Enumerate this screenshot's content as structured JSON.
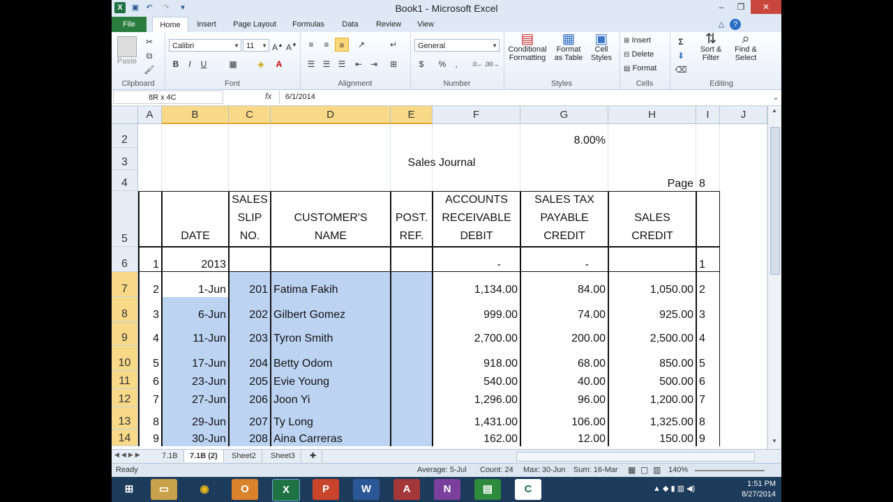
{
  "window": {
    "title": "Book1 - Microsoft Excel",
    "min": "–",
    "restore": "❐",
    "close": "✕"
  },
  "quick_access": {
    "save_icon": "save-icon",
    "undo_icon": "undo-icon",
    "redo_icon": "redo-icon"
  },
  "ribbon_tabs": [
    "File",
    "Home",
    "Insert",
    "Page Layout",
    "Formulas",
    "Data",
    "Review",
    "View"
  ],
  "ribbon": {
    "clipboard": {
      "label": "Clipboard",
      "paste": "Paste"
    },
    "font": {
      "label": "Font",
      "name": "Calibri",
      "size": "11",
      "bold": "B",
      "italic": "I",
      "underline": "U"
    },
    "alignment": {
      "label": "Alignment"
    },
    "number": {
      "label": "Number",
      "format": "General",
      "currency": "$",
      "percent": "%",
      "comma": ","
    },
    "styles": {
      "label": "Styles",
      "conditional": "Conditional Formatting",
      "format_table": "Format as Table",
      "cell_styles": "Cell Styles"
    },
    "cells": {
      "label": "Cells",
      "insert": "Insert",
      "delete": "Delete",
      "format": "Format"
    },
    "editing": {
      "label": "Editing",
      "sort": "Sort & Filter",
      "find": "Find & Select",
      "autosum": "Σ"
    }
  },
  "formula_bar": {
    "name_box": "8R x 4C",
    "fx": "fx",
    "value": "6/1/2014"
  },
  "columns": [
    "A",
    "B",
    "C",
    "D",
    "E",
    "F",
    "G",
    "H",
    "I",
    "J"
  ],
  "rows": [
    "2",
    "3",
    "4",
    "5",
    "6",
    "7",
    "8",
    "9",
    "10",
    "11",
    "12",
    "13",
    "14"
  ],
  "sheet": {
    "tax_rate": "8.00%",
    "title": "Sales Journal",
    "page_label": "Page",
    "page_number": "8",
    "headers": {
      "date": "DATE",
      "slip": [
        "SALES",
        "SLIP",
        "NO."
      ],
      "customer": [
        "CUSTOMER'S",
        "NAME"
      ],
      "post": [
        "POST.",
        "REF."
      ],
      "ar": [
        "ACCOUNTS",
        "RECEIVABLE",
        "DEBIT"
      ],
      "tax": [
        "SALES TAX",
        "PAYABLE",
        "CREDIT"
      ],
      "sales": [
        "SALES",
        "CREDIT"
      ]
    },
    "row6": {
      "a": "1",
      "b": "2013",
      "f": "-",
      "g": "-",
      "i": "1"
    },
    "entries": [
      {
        "a": "2",
        "date": "1-Jun",
        "slip": "201",
        "name": "Fatima Fakih",
        "ar": "1,134.00",
        "tax": "84.00",
        "sales": "1,050.00",
        "i": "2"
      },
      {
        "a": "3",
        "date": "6-Jun",
        "slip": "202",
        "name": "Gilbert Gomez",
        "ar": "999.00",
        "tax": "74.00",
        "sales": "925.00",
        "i": "3"
      },
      {
        "a": "4",
        "date": "11-Jun",
        "slip": "203",
        "name": "Tyron Smith",
        "ar": "2,700.00",
        "tax": "200.00",
        "sales": "2,500.00",
        "i": "4"
      },
      {
        "a": "5",
        "date": "17-Jun",
        "slip": "204",
        "name": "Betty Odom",
        "ar": "918.00",
        "tax": "68.00",
        "sales": "850.00",
        "i": "5"
      },
      {
        "a": "6",
        "date": "23-Jun",
        "slip": "205",
        "name": "Evie Young",
        "ar": "540.00",
        "tax": "40.00",
        "sales": "500.00",
        "i": "6"
      },
      {
        "a": "7",
        "date": "27-Jun",
        "slip": "206",
        "name": "Joon Yi",
        "ar": "1,296.00",
        "tax": "96.00",
        "sales": "1,200.00",
        "i": "7"
      },
      {
        "a": "8",
        "date": "29-Jun",
        "slip": "207",
        "name": "Ty Long",
        "ar": "1,431.00",
        "tax": "106.00",
        "sales": "1,325.00",
        "i": "8"
      },
      {
        "a": "9",
        "date": "30-Jun",
        "slip": "208",
        "name": "Aina Carreras",
        "ar": "162.00",
        "tax": "12.00",
        "sales": "150.00",
        "i": "9"
      }
    ]
  },
  "sheet_tabs": [
    "7.1B",
    "7.1B (2)",
    "Sheet2",
    "Sheet3"
  ],
  "status": {
    "ready": "Ready",
    "average": "Average: 5-Jul",
    "count": "Count: 24",
    "max": "Max: 30-Jun",
    "sum": "Sum: 16-Mar",
    "zoom": "140%"
  },
  "taskbar": {
    "time": "1:51 PM",
    "date": "8/27/2014"
  },
  "colors": {
    "selection": "#bcd4f2",
    "header_selected": "#f7d987",
    "file_tab": "#2a7d3f",
    "excel_green": "#1f7244"
  }
}
